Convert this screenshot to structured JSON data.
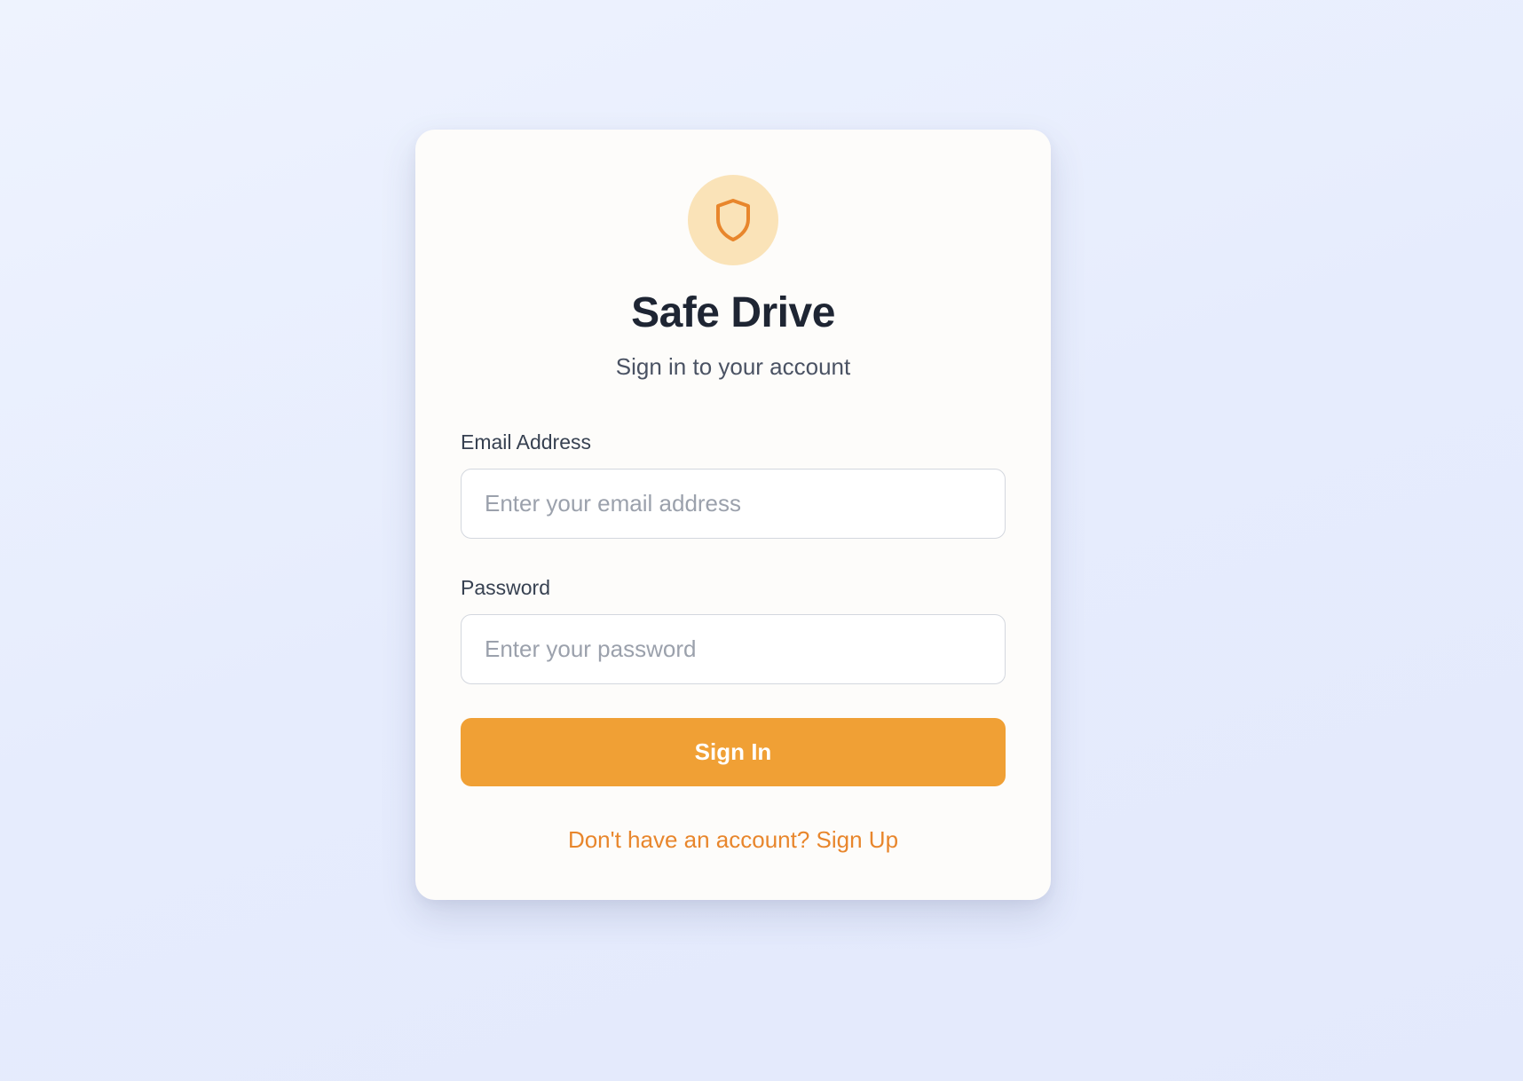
{
  "app": {
    "title": "Safe Drive",
    "subtitle": "Sign in to your account",
    "logo_icon": "shield-icon"
  },
  "form": {
    "email": {
      "label": "Email Address",
      "placeholder": "Enter your email address",
      "value": ""
    },
    "password": {
      "label": "Password",
      "placeholder": "Enter your password",
      "value": ""
    },
    "submit_label": "Sign In"
  },
  "footer": {
    "signup_text": "Don't have an account? Sign Up"
  },
  "colors": {
    "accent": "#f0a035",
    "accent_dark": "#e8862c",
    "logo_bg": "#fae3b8",
    "heading": "#1e2533",
    "subtext": "#4a5263",
    "label": "#374151"
  }
}
